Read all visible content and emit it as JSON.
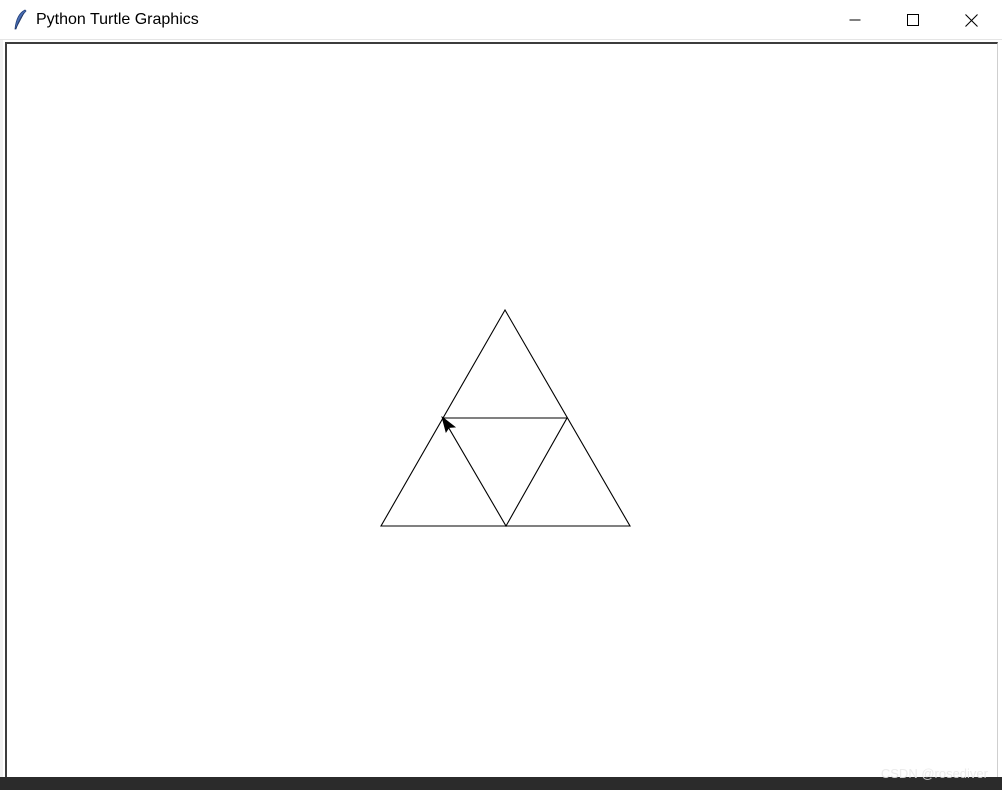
{
  "window": {
    "title": "Python Turtle Graphics",
    "icon": "feather-icon",
    "controls": {
      "minimize_icon": "minimize-icon",
      "maximize_icon": "maximize-icon",
      "close_icon": "close-icon"
    }
  },
  "canvas": {
    "background": "#ffffff",
    "pen_color": "#000000",
    "shapes": "sierpinski-triangle-level-1",
    "turtle_cursor": "arrow-cursor"
  },
  "watermark": {
    "text": "CSDN @rosediver"
  }
}
